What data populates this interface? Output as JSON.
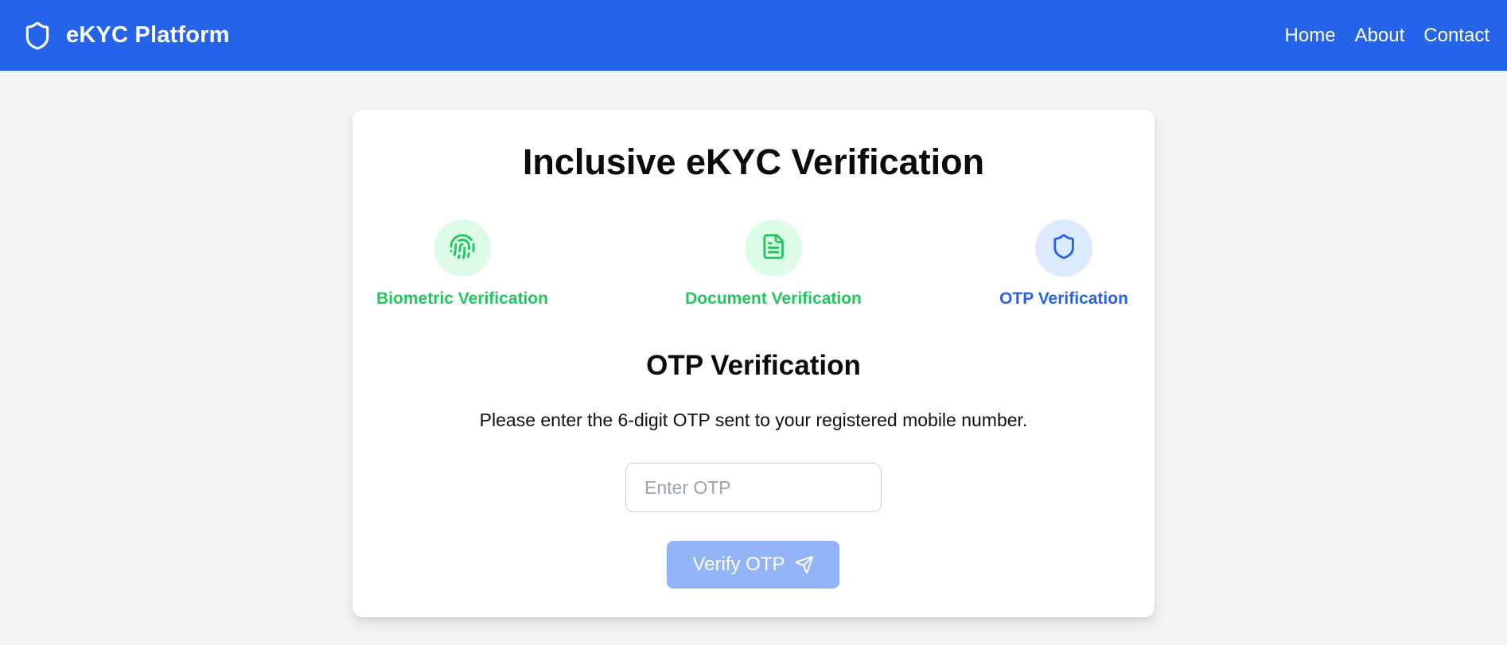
{
  "header": {
    "brand": "eKYC Platform",
    "brand_icon": "shield-icon",
    "nav": [
      "Home",
      "About",
      "Contact"
    ],
    "background": "#2563eb"
  },
  "card": {
    "title": "Inclusive eKYC Verification",
    "steps": [
      {
        "label": "Biometric Verification",
        "icon": "fingerprint-icon",
        "status": "completed",
        "color": "#22c55e"
      },
      {
        "label": "Document Verification",
        "icon": "document-icon",
        "status": "completed",
        "color": "#22c55e"
      },
      {
        "label": "OTP Verification",
        "icon": "shield-icon",
        "status": "active",
        "color": "#2563eb"
      }
    ],
    "otp": {
      "title": "OTP Verification",
      "instruction": "Please enter the 6-digit OTP sent to your registered mobile number.",
      "input_placeholder": "Enter OTP",
      "input_value": "",
      "button_label": "Verify OTP",
      "button_icon": "send-icon"
    }
  }
}
